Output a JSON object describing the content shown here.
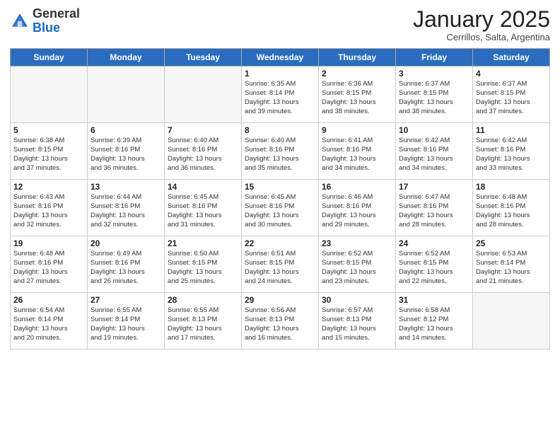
{
  "header": {
    "logo_general": "General",
    "logo_blue": "Blue",
    "month_title": "January 2025",
    "location": "Cerrillos, Salta, Argentina"
  },
  "weekdays": [
    "Sunday",
    "Monday",
    "Tuesday",
    "Wednesday",
    "Thursday",
    "Friday",
    "Saturday"
  ],
  "weeks": [
    [
      {
        "day": "",
        "info": ""
      },
      {
        "day": "",
        "info": ""
      },
      {
        "day": "",
        "info": ""
      },
      {
        "day": "1",
        "info": "Sunrise: 6:35 AM\nSunset: 8:14 PM\nDaylight: 13 hours\nand 39 minutes."
      },
      {
        "day": "2",
        "info": "Sunrise: 6:36 AM\nSunset: 8:15 PM\nDaylight: 13 hours\nand 38 minutes."
      },
      {
        "day": "3",
        "info": "Sunrise: 6:37 AM\nSunset: 8:15 PM\nDaylight: 13 hours\nand 38 minutes."
      },
      {
        "day": "4",
        "info": "Sunrise: 6:37 AM\nSunset: 8:15 PM\nDaylight: 13 hours\nand 37 minutes."
      }
    ],
    [
      {
        "day": "5",
        "info": "Sunrise: 6:38 AM\nSunset: 8:15 PM\nDaylight: 13 hours\nand 37 minutes."
      },
      {
        "day": "6",
        "info": "Sunrise: 6:39 AM\nSunset: 8:16 PM\nDaylight: 13 hours\nand 36 minutes."
      },
      {
        "day": "7",
        "info": "Sunrise: 6:40 AM\nSunset: 8:16 PM\nDaylight: 13 hours\nand 36 minutes."
      },
      {
        "day": "8",
        "info": "Sunrise: 6:40 AM\nSunset: 8:16 PM\nDaylight: 13 hours\nand 35 minutes."
      },
      {
        "day": "9",
        "info": "Sunrise: 6:41 AM\nSunset: 8:16 PM\nDaylight: 13 hours\nand 34 minutes."
      },
      {
        "day": "10",
        "info": "Sunrise: 6:42 AM\nSunset: 8:16 PM\nDaylight: 13 hours\nand 34 minutes."
      },
      {
        "day": "11",
        "info": "Sunrise: 6:42 AM\nSunset: 8:16 PM\nDaylight: 13 hours\nand 33 minutes."
      }
    ],
    [
      {
        "day": "12",
        "info": "Sunrise: 6:43 AM\nSunset: 8:16 PM\nDaylight: 13 hours\nand 32 minutes."
      },
      {
        "day": "13",
        "info": "Sunrise: 6:44 AM\nSunset: 8:16 PM\nDaylight: 13 hours\nand 32 minutes."
      },
      {
        "day": "14",
        "info": "Sunrise: 6:45 AM\nSunset: 8:16 PM\nDaylight: 13 hours\nand 31 minutes."
      },
      {
        "day": "15",
        "info": "Sunrise: 6:45 AM\nSunset: 8:16 PM\nDaylight: 13 hours\nand 30 minutes."
      },
      {
        "day": "16",
        "info": "Sunrise: 6:46 AM\nSunset: 8:16 PM\nDaylight: 13 hours\nand 29 minutes."
      },
      {
        "day": "17",
        "info": "Sunrise: 6:47 AM\nSunset: 8:16 PM\nDaylight: 13 hours\nand 28 minutes."
      },
      {
        "day": "18",
        "info": "Sunrise: 6:48 AM\nSunset: 8:16 PM\nDaylight: 13 hours\nand 28 minutes."
      }
    ],
    [
      {
        "day": "19",
        "info": "Sunrise: 6:48 AM\nSunset: 8:16 PM\nDaylight: 13 hours\nand 27 minutes."
      },
      {
        "day": "20",
        "info": "Sunrise: 6:49 AM\nSunset: 8:16 PM\nDaylight: 13 hours\nand 26 minutes."
      },
      {
        "day": "21",
        "info": "Sunrise: 6:50 AM\nSunset: 8:15 PM\nDaylight: 13 hours\nand 25 minutes."
      },
      {
        "day": "22",
        "info": "Sunrise: 6:51 AM\nSunset: 8:15 PM\nDaylight: 13 hours\nand 24 minutes."
      },
      {
        "day": "23",
        "info": "Sunrise: 6:52 AM\nSunset: 8:15 PM\nDaylight: 13 hours\nand 23 minutes."
      },
      {
        "day": "24",
        "info": "Sunrise: 6:52 AM\nSunset: 8:15 PM\nDaylight: 13 hours\nand 22 minutes."
      },
      {
        "day": "25",
        "info": "Sunrise: 6:53 AM\nSunset: 8:14 PM\nDaylight: 13 hours\nand 21 minutes."
      }
    ],
    [
      {
        "day": "26",
        "info": "Sunrise: 6:54 AM\nSunset: 8:14 PM\nDaylight: 13 hours\nand 20 minutes."
      },
      {
        "day": "27",
        "info": "Sunrise: 6:55 AM\nSunset: 8:14 PM\nDaylight: 13 hours\nand 19 minutes."
      },
      {
        "day": "28",
        "info": "Sunrise: 6:55 AM\nSunset: 8:13 PM\nDaylight: 13 hours\nand 17 minutes."
      },
      {
        "day": "29",
        "info": "Sunrise: 6:56 AM\nSunset: 8:13 PM\nDaylight: 13 hours\nand 16 minutes."
      },
      {
        "day": "30",
        "info": "Sunrise: 6:57 AM\nSunset: 8:13 PM\nDaylight: 13 hours\nand 15 minutes."
      },
      {
        "day": "31",
        "info": "Sunrise: 6:58 AM\nSunset: 8:12 PM\nDaylight: 13 hours\nand 14 minutes."
      },
      {
        "day": "",
        "info": ""
      }
    ]
  ]
}
